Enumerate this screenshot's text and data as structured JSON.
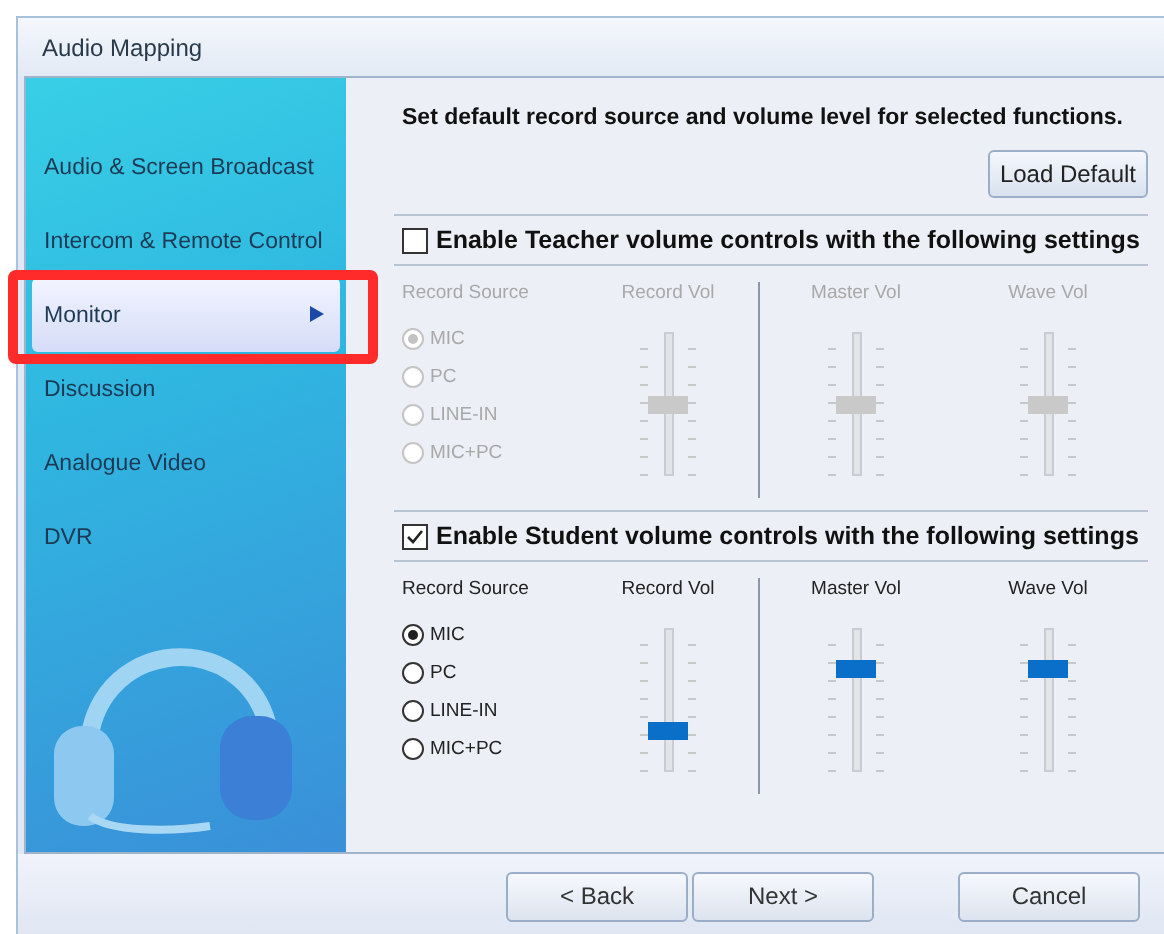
{
  "window": {
    "title": "Audio Mapping"
  },
  "sidebar": {
    "items": [
      {
        "label": "Audio & Screen Broadcast",
        "selected": false,
        "highlighted": false
      },
      {
        "label": "Intercom & Remote Control",
        "selected": false,
        "highlighted": false
      },
      {
        "label": "Monitor",
        "selected": true,
        "highlighted": true
      },
      {
        "label": "Discussion",
        "selected": false,
        "highlighted": false
      },
      {
        "label": "Analogue Video",
        "selected": false,
        "highlighted": false
      },
      {
        "label": "DVR",
        "selected": false,
        "highlighted": false
      }
    ]
  },
  "description": "Set default record source and volume level for selected functions.",
  "load_default_button": "Load Default",
  "sections": [
    {
      "label": "Enable Teacher volume controls with the following settings",
      "checked": false,
      "source_heading": "Record Source",
      "sources": [
        {
          "label": "MIC",
          "selected": true
        },
        {
          "label": "PC",
          "selected": false
        },
        {
          "label": "LINE-IN",
          "selected": false
        },
        {
          "label": "MIC+PC",
          "selected": false
        }
      ],
      "sliders": [
        {
          "label": "Record Vol",
          "level": 0.5
        },
        {
          "label": "Master Vol",
          "level": 0.5
        },
        {
          "label": "Wave Vol",
          "level": 0.5
        }
      ]
    },
    {
      "label": "Enable Student volume controls with the following settings",
      "checked": true,
      "source_heading": "Record Source",
      "sources": [
        {
          "label": "MIC",
          "selected": true
        },
        {
          "label": "PC",
          "selected": false
        },
        {
          "label": "LINE-IN",
          "selected": false
        },
        {
          "label": "MIC+PC",
          "selected": false
        }
      ],
      "sliders": [
        {
          "label": "Record Vol",
          "level": 0.25
        },
        {
          "label": "Master Vol",
          "level": 0.75
        },
        {
          "label": "Wave Vol",
          "level": 0.75
        }
      ]
    }
  ],
  "buttons": [
    {
      "label": "< Back"
    },
    {
      "label": "Next >"
    },
    {
      "label": "Cancel"
    }
  ]
}
